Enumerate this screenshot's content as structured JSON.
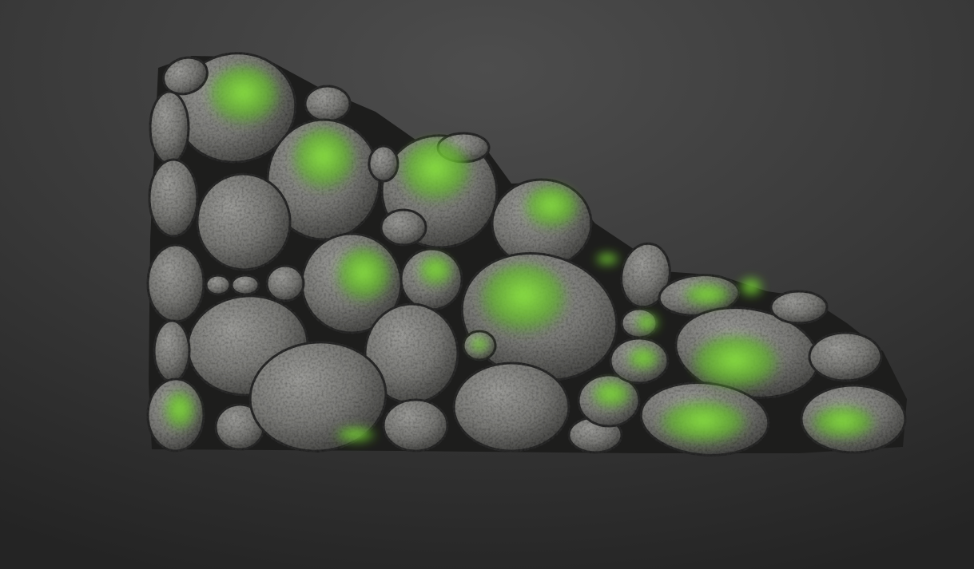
{
  "scene": {
    "subject": "mossy-stone-wall-model",
    "palette": {
      "background_top": "#4a4a4a",
      "background_bottom": "#262626",
      "stone_light": "#8f8f8c",
      "stone_mid": "#6f6f6c",
      "stone_dark": "#3d3d3b",
      "mortar": "#1c1c1b",
      "moss_bright": "#7fdc3a",
      "moss_dark": "#3f7f1e"
    }
  }
}
